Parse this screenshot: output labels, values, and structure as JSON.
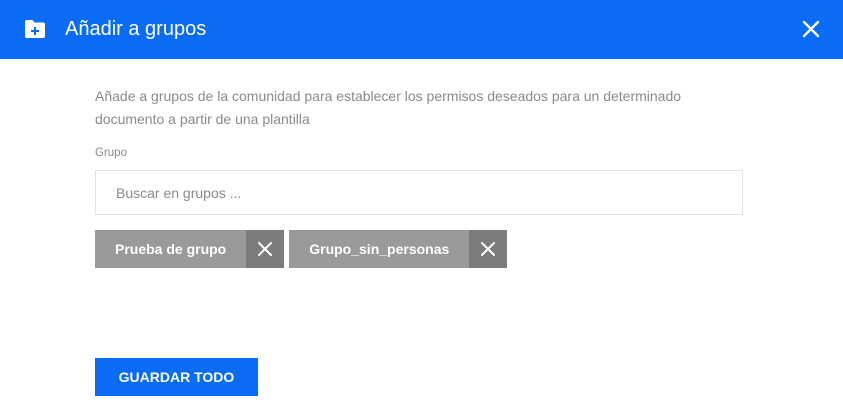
{
  "header": {
    "title": "Añadir a grupos",
    "icon": "folder-plus-icon",
    "close_icon": "close-icon",
    "background": "#0a6cf5"
  },
  "body": {
    "description": "Añade a grupos de la comunidad para establecer los permisos deseados para un determinado documento a partir de una plantilla",
    "group_label": "Grupo",
    "search_placeholder": "Buscar en grupos ...",
    "search_value": ""
  },
  "tags": [
    {
      "label": "Prueba de grupo",
      "remove_icon": "close-icon"
    },
    {
      "label": "Grupo_sin_personas",
      "remove_icon": "close-icon"
    }
  ],
  "footer": {
    "save_label": "GUARDAR TODO"
  },
  "colors": {
    "accent": "#0a6cf5",
    "tag_background": "#9a9a9a",
    "tag_remove_background": "#7c7c7c",
    "muted_text": "#8a8a8a"
  }
}
